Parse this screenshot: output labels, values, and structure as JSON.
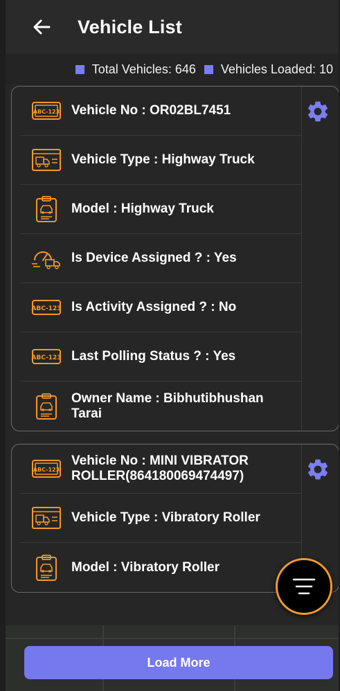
{
  "appbar": {
    "title": "Vehicle List",
    "back_icon": "arrow-left-icon"
  },
  "stats": {
    "total_label": "Total Vehicles: 646",
    "loaded_label": "Vehicles Loaded: 10",
    "square_color": "#7b7ef2"
  },
  "vehicles": [
    {
      "rows": [
        {
          "icon": "license-plate-icon",
          "text": "Vehicle No : OR02BL7451"
        },
        {
          "icon": "truck-document-icon",
          "text": "Vehicle Type : Highway Truck"
        },
        {
          "icon": "clipboard-car-icon",
          "text": "Model : Highway Truck"
        },
        {
          "icon": "speedometer-truck-icon",
          "text": "Is Device Assigned ? : Yes"
        },
        {
          "icon": "abc-plate-icon",
          "text": "Is Activity Assigned ? : No"
        },
        {
          "icon": "abc-plate-icon",
          "text": "Last Polling Status ? : Yes"
        },
        {
          "icon": "clipboard-car-icon",
          "text": "Owner Name :  Bibhutibhushan Tarai"
        }
      ]
    },
    {
      "rows": [
        {
          "icon": "license-plate-icon",
          "text": "Vehicle No : MINI VIBRATOR ROLLER(864180069474497)"
        },
        {
          "icon": "truck-document-icon",
          "text": "Vehicle Type : Vibratory Roller"
        },
        {
          "icon": "clipboard-car-icon",
          "text": "Model : Vibratory Roller"
        }
      ]
    }
  ],
  "load_more": {
    "label": "Load More"
  },
  "fab": {
    "icon": "filter-lines-icon"
  },
  "colors": {
    "accent_orange": "#f39a2a",
    "accent_purple": "#7678ee",
    "gear_color": "#7b7ef2"
  }
}
